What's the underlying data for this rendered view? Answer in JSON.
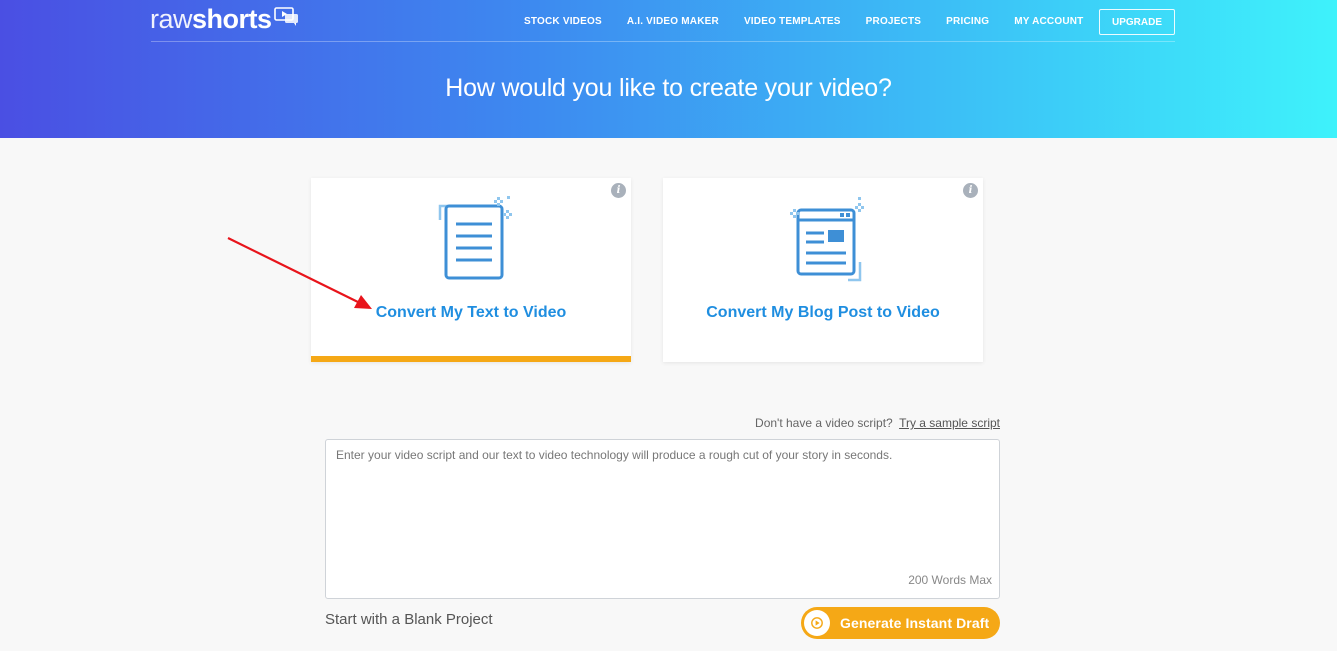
{
  "header": {
    "logo": {
      "raw": "raw",
      "shorts": "shorts"
    },
    "nav": [
      {
        "label": "STOCK VIDEOS"
      },
      {
        "label": "A.I. VIDEO MAKER"
      },
      {
        "label": "VIDEO TEMPLATES"
      },
      {
        "label": "PROJECTS"
      },
      {
        "label": "PRICING"
      },
      {
        "label": "MY ACCOUNT"
      }
    ],
    "upgrade_label": "UPGRADE",
    "title": "How would you like to create your video?"
  },
  "cards": [
    {
      "label": "Convert My Text to Video",
      "icon": "document-icon",
      "selected": true
    },
    {
      "label": "Convert My Blog Post to Video",
      "icon": "browser-page-icon",
      "selected": false
    }
  ],
  "colors": {
    "accent": "#1f8ee0",
    "selected_bar": "#f5a816",
    "button": "#f5a816"
  },
  "script": {
    "prompt_text": "Don't have a video script?",
    "sample_link": "Try a sample script",
    "placeholder": "Enter your video script and our text to video technology will produce a rough cut of your story in seconds.",
    "value": "",
    "word_limit": "200 Words Max"
  },
  "footer": {
    "blank_project": "Start with a Blank Project",
    "generate_label": "Generate Instant Draft"
  }
}
